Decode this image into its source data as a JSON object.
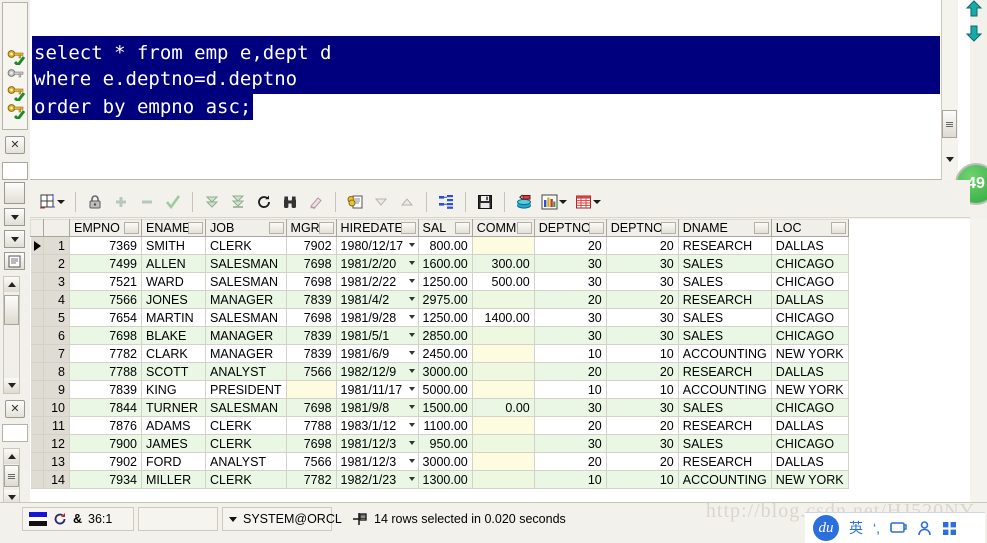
{
  "editor": {
    "sql_lines": [
      "select * from emp e,dept d",
      "where e.deptno=d.deptno",
      "order by empno asc;"
    ],
    "selection_color": "#00007e",
    "text_color": "#ffffff"
  },
  "nav": {
    "up_icon": "arrow-up-icon",
    "down_icon": "arrow-down-icon"
  },
  "badge": {
    "value": "49"
  },
  "left_strip": {
    "icons": [
      "key-checked-icon",
      "key-gray-icon",
      "key-checked-icon",
      "key-checked-icon"
    ],
    "close_label": "✕"
  },
  "toolbar": {
    "buttons": [
      {
        "name": "grid-view-button",
        "icon": "grid-icon",
        "has_caret": true
      },
      {
        "name": "lock-button",
        "icon": "lock-icon",
        "has_caret": false
      },
      {
        "name": "add-row-button",
        "icon": "plus-icon",
        "has_caret": false
      },
      {
        "name": "delete-row-button",
        "icon": "minus-icon",
        "has_caret": false
      },
      {
        "name": "commit-button",
        "icon": "check-icon",
        "has_caret": false
      },
      {
        "name": "fetch-next-button",
        "icon": "double-down-arrow-icon",
        "has_caret": false
      },
      {
        "name": "fetch-all-button",
        "icon": "double-down-bar-icon",
        "has_caret": false
      },
      {
        "name": "refresh-button",
        "icon": "refresh-icon",
        "has_caret": false
      },
      {
        "name": "find-button",
        "icon": "binoculars-icon",
        "has_caret": false
      },
      {
        "name": "clear-button",
        "icon": "eraser-icon",
        "has_caret": false
      },
      {
        "name": "single-record-button",
        "icon": "record-page-icon",
        "has_caret": false
      },
      {
        "name": "sort-desc-button",
        "icon": "triangle-down-icon",
        "has_caret": false
      },
      {
        "name": "sort-asc-button",
        "icon": "triangle-up-icon",
        "has_caret": false
      },
      {
        "name": "explain-plan-button",
        "icon": "tree-hierarchy-icon",
        "has_caret": false
      },
      {
        "name": "save-button",
        "icon": "floppy-save-icon",
        "has_caret": false
      },
      {
        "name": "export-db-button",
        "icon": "database-export-icon",
        "has_caret": false
      },
      {
        "name": "chart-button",
        "icon": "bar-chart-icon",
        "has_caret": true
      },
      {
        "name": "table-style-button",
        "icon": "red-table-icon",
        "has_caret": true
      }
    ]
  },
  "grid": {
    "columns": [
      "EMPNO",
      "ENAME",
      "JOB",
      "MGR",
      "HIREDATE",
      "SAL",
      "COMM",
      "DEPTNO",
      "DEPTNO",
      "DNAME",
      "LOC"
    ],
    "current_row": 1,
    "rows": [
      {
        "n": "1",
        "EMPNO": "7369",
        "ENAME": "SMITH",
        "JOB": "CLERK",
        "MGR": "7902",
        "HIREDATE": "1980/12/17",
        "SAL": "800.00",
        "COMM": "",
        "DEPTNO": "20",
        "DEPTNO2": "20",
        "DNAME": "RESEARCH",
        "LOC": "DALLAS"
      },
      {
        "n": "2",
        "EMPNO": "7499",
        "ENAME": "ALLEN",
        "JOB": "SALESMAN",
        "MGR": "7698",
        "HIREDATE": "1981/2/20",
        "SAL": "1600.00",
        "COMM": "300.00",
        "DEPTNO": "30",
        "DEPTNO2": "30",
        "DNAME": "SALES",
        "LOC": "CHICAGO"
      },
      {
        "n": "3",
        "EMPNO": "7521",
        "ENAME": "WARD",
        "JOB": "SALESMAN",
        "MGR": "7698",
        "HIREDATE": "1981/2/22",
        "SAL": "1250.00",
        "COMM": "500.00",
        "DEPTNO": "30",
        "DEPTNO2": "30",
        "DNAME": "SALES",
        "LOC": "CHICAGO"
      },
      {
        "n": "4",
        "EMPNO": "7566",
        "ENAME": "JONES",
        "JOB": "MANAGER",
        "MGR": "7839",
        "HIREDATE": "1981/4/2",
        "SAL": "2975.00",
        "COMM": "",
        "DEPTNO": "20",
        "DEPTNO2": "20",
        "DNAME": "RESEARCH",
        "LOC": "DALLAS"
      },
      {
        "n": "5",
        "EMPNO": "7654",
        "ENAME": "MARTIN",
        "JOB": "SALESMAN",
        "MGR": "7698",
        "HIREDATE": "1981/9/28",
        "SAL": "1250.00",
        "COMM": "1400.00",
        "DEPTNO": "30",
        "DEPTNO2": "30",
        "DNAME": "SALES",
        "LOC": "CHICAGO"
      },
      {
        "n": "6",
        "EMPNO": "7698",
        "ENAME": "BLAKE",
        "JOB": "MANAGER",
        "MGR": "7839",
        "HIREDATE": "1981/5/1",
        "SAL": "2850.00",
        "COMM": "",
        "DEPTNO": "30",
        "DEPTNO2": "30",
        "DNAME": "SALES",
        "LOC": "CHICAGO"
      },
      {
        "n": "7",
        "EMPNO": "7782",
        "ENAME": "CLARK",
        "JOB": "MANAGER",
        "MGR": "7839",
        "HIREDATE": "1981/6/9",
        "SAL": "2450.00",
        "COMM": "",
        "DEPTNO": "10",
        "DEPTNO2": "10",
        "DNAME": "ACCOUNTING",
        "LOC": "NEW YORK"
      },
      {
        "n": "8",
        "EMPNO": "7788",
        "ENAME": "SCOTT",
        "JOB": "ANALYST",
        "MGR": "7566",
        "HIREDATE": "1982/12/9",
        "SAL": "3000.00",
        "COMM": "",
        "DEPTNO": "20",
        "DEPTNO2": "20",
        "DNAME": "RESEARCH",
        "LOC": "DALLAS"
      },
      {
        "n": "9",
        "EMPNO": "7839",
        "ENAME": "KING",
        "JOB": "PRESIDENT",
        "MGR": "",
        "HIREDATE": "1981/11/17",
        "SAL": "5000.00",
        "COMM": "",
        "DEPTNO": "10",
        "DEPTNO2": "10",
        "DNAME": "ACCOUNTING",
        "LOC": "NEW YORK"
      },
      {
        "n": "10",
        "EMPNO": "7844",
        "ENAME": "TURNER",
        "JOB": "SALESMAN",
        "MGR": "7698",
        "HIREDATE": "1981/9/8",
        "SAL": "1500.00",
        "COMM": "0.00",
        "DEPTNO": "30",
        "DEPTNO2": "30",
        "DNAME": "SALES",
        "LOC": "CHICAGO"
      },
      {
        "n": "11",
        "EMPNO": "7876",
        "ENAME": "ADAMS",
        "JOB": "CLERK",
        "MGR": "7788",
        "HIREDATE": "1983/1/12",
        "SAL": "1100.00",
        "COMM": "",
        "DEPTNO": "20",
        "DEPTNO2": "20",
        "DNAME": "RESEARCH",
        "LOC": "DALLAS"
      },
      {
        "n": "12",
        "EMPNO": "7900",
        "ENAME": "JAMES",
        "JOB": "CLERK",
        "MGR": "7698",
        "HIREDATE": "1981/12/3",
        "SAL": "950.00",
        "COMM": "",
        "DEPTNO": "30",
        "DEPTNO2": "30",
        "DNAME": "SALES",
        "LOC": "CHICAGO"
      },
      {
        "n": "13",
        "EMPNO": "7902",
        "ENAME": "FORD",
        "JOB": "ANALYST",
        "MGR": "7566",
        "HIREDATE": "1981/12/3",
        "SAL": "3000.00",
        "COMM": "",
        "DEPTNO": "20",
        "DEPTNO2": "20",
        "DNAME": "RESEARCH",
        "LOC": "DALLAS"
      },
      {
        "n": "14",
        "EMPNO": "7934",
        "ENAME": "MILLER",
        "JOB": "CLERK",
        "MGR": "7782",
        "HIREDATE": "1982/1/23",
        "SAL": "1300.00",
        "COMM": "",
        "DEPTNO": "10",
        "DEPTNO2": "10",
        "DNAME": "ACCOUNTING",
        "LOC": "NEW YORK"
      }
    ]
  },
  "statusbar": {
    "flag_icon": "flag-icon",
    "refresh_icon": "refresh-red-icon",
    "ampersand": "&",
    "cursor_position": "36:1",
    "connection": "SYSTEM@ORCL",
    "connection_caret": "chevron-down-icon",
    "result_icon": "pin-flag-icon",
    "result_message": "14 rows selected in 0.020 seconds"
  },
  "watermark": {
    "text": "http://blog.csdn.net/HJ520NY"
  },
  "ime": {
    "logo": "baidu-ime-logo",
    "items": [
      "英",
      "‘,",
      "keyboard-icon",
      "user-icon",
      "apps-icon"
    ]
  }
}
